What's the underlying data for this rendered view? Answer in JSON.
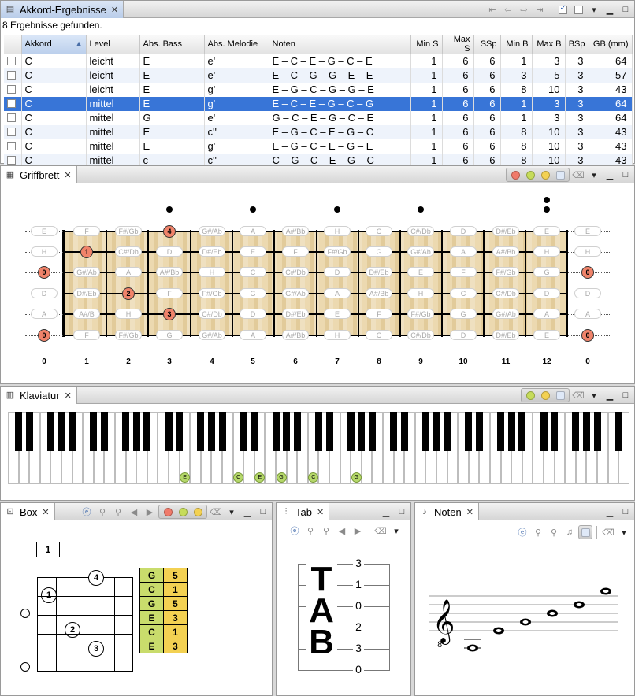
{
  "results_view": {
    "tab_title": "Akkord-Ergebnisse",
    "status": "8 Ergebnisse gefunden.",
    "columns": [
      "Akkord",
      "Level",
      "Abs. Bass",
      "Abs. Melodie",
      "Noten",
      "Min S",
      "Max S",
      "SSp",
      "Min B",
      "Max B",
      "BSp",
      "GB (mm)"
    ],
    "rows": [
      [
        "C",
        "leicht",
        "E",
        "e'",
        "E – C – E – G – C – E",
        "1",
        "6",
        "6",
        "1",
        "3",
        "3",
        "64"
      ],
      [
        "C",
        "leicht",
        "E",
        "e'",
        "E – C – G – G – E – E",
        "1",
        "6",
        "6",
        "3",
        "5",
        "3",
        "57"
      ],
      [
        "C",
        "leicht",
        "E",
        "g'",
        "E – G – C – G – G – E",
        "1",
        "6",
        "6",
        "8",
        "10",
        "3",
        "43"
      ],
      [
        "C",
        "mittel",
        "E",
        "g'",
        "E – C – E – G – C – G",
        "1",
        "6",
        "6",
        "1",
        "3",
        "3",
        "64"
      ],
      [
        "C",
        "mittel",
        "G",
        "e'",
        "G – C – E – G – C – E",
        "1",
        "6",
        "6",
        "1",
        "3",
        "3",
        "64"
      ],
      [
        "C",
        "mittel",
        "E",
        "c''",
        "E – G – C – E – G – C",
        "1",
        "6",
        "6",
        "8",
        "10",
        "3",
        "43"
      ],
      [
        "C",
        "mittel",
        "E",
        "g'",
        "E – G – C – E – G – E",
        "1",
        "6",
        "6",
        "8",
        "10",
        "3",
        "43"
      ],
      [
        "C",
        "mittel",
        "c",
        "c''",
        "C – G – C – E – G – C",
        "1",
        "6",
        "6",
        "8",
        "10",
        "3",
        "43"
      ]
    ],
    "selected_row": 3
  },
  "griffbrett_view": {
    "tab_title": "Griffbrett",
    "strings_top_to_bottom": [
      [
        "E",
        "F",
        "F#/Gb",
        "G",
        "G#/Ab",
        "A",
        "A#/Bb",
        "H",
        "C",
        "C#/Db",
        "D",
        "D#/Eb",
        "E",
        "E"
      ],
      [
        "H",
        "C",
        "C#/Db",
        "D",
        "D#/Eb",
        "E",
        "F",
        "F#/Gb",
        "G",
        "G#/Ab",
        "A",
        "A#/Bb",
        "H",
        "H"
      ],
      [
        "G",
        "G#/Ab",
        "A",
        "A#/Bb",
        "H",
        "C",
        "C#/Db",
        "D",
        "D#/Eb",
        "E",
        "F",
        "F#/Gb",
        "G",
        "G"
      ],
      [
        "D",
        "D#/Eb",
        "E",
        "F",
        "F#/Gb",
        "G",
        "G#/Ab",
        "A",
        "A#/Bb",
        "H",
        "C",
        "C#/Db",
        "D",
        "D"
      ],
      [
        "A",
        "A#/B",
        "H",
        "C",
        "C#/Db",
        "D",
        "D#/Eb",
        "E",
        "F",
        "F#/Gb",
        "G",
        "G#/Ab",
        "A",
        "A"
      ],
      [
        "E",
        "F",
        "F#/Gb",
        "G",
        "G#/Ab",
        "A",
        "A#/Bb",
        "H",
        "C",
        "C#/Db",
        "D",
        "D#/Eb",
        "E",
        "E"
      ]
    ],
    "fingers": [
      {
        "string": 0,
        "fret": 3,
        "label": "4"
      },
      {
        "string": 1,
        "fret": 1,
        "label": "1"
      },
      {
        "string": 2,
        "fret": 0,
        "label": "0"
      },
      {
        "string": 3,
        "fret": 2,
        "label": "2"
      },
      {
        "string": 4,
        "fret": 3,
        "label": "3"
      },
      {
        "string": 5,
        "fret": 0,
        "label": "0"
      }
    ],
    "fret_numbers": [
      "0",
      "1",
      "2",
      "3",
      "4",
      "5",
      "6",
      "7",
      "8",
      "9",
      "10",
      "11",
      "12",
      "0"
    ],
    "colors": {
      "finger": "#f0836a",
      "wood": "#e8d3a6"
    }
  },
  "klaviatur_view": {
    "tab_title": "Klaviatur",
    "marked_keys": [
      {
        "white_index": 16,
        "label": "E"
      },
      {
        "white_index": 21,
        "label": "C"
      },
      {
        "white_index": 23,
        "label": "E"
      },
      {
        "white_index": 25,
        "label": "G"
      },
      {
        "white_index": 28,
        "label": "C"
      },
      {
        "white_index": 32,
        "label": "G"
      }
    ],
    "colors": {
      "mark": "#b5d86a"
    }
  },
  "box_view": {
    "tab_title": "Box",
    "start_fret": "1",
    "notes": [
      {
        "note": "G",
        "finger": "5"
      },
      {
        "note": "C",
        "finger": "1"
      },
      {
        "note": "G",
        "finger": "5"
      },
      {
        "note": "E",
        "finger": "3"
      },
      {
        "note": "C",
        "finger": "1"
      },
      {
        "note": "E",
        "finger": "3"
      }
    ],
    "fingers": [
      "4",
      "1",
      "2",
      "3"
    ]
  },
  "tab_view": {
    "tab_title": "Tab",
    "clef_letters": [
      "T",
      "A",
      "B"
    ],
    "frets": [
      "3",
      "1",
      "0",
      "2",
      "3",
      "0"
    ]
  },
  "noten_view": {
    "tab_title": "Noten"
  }
}
